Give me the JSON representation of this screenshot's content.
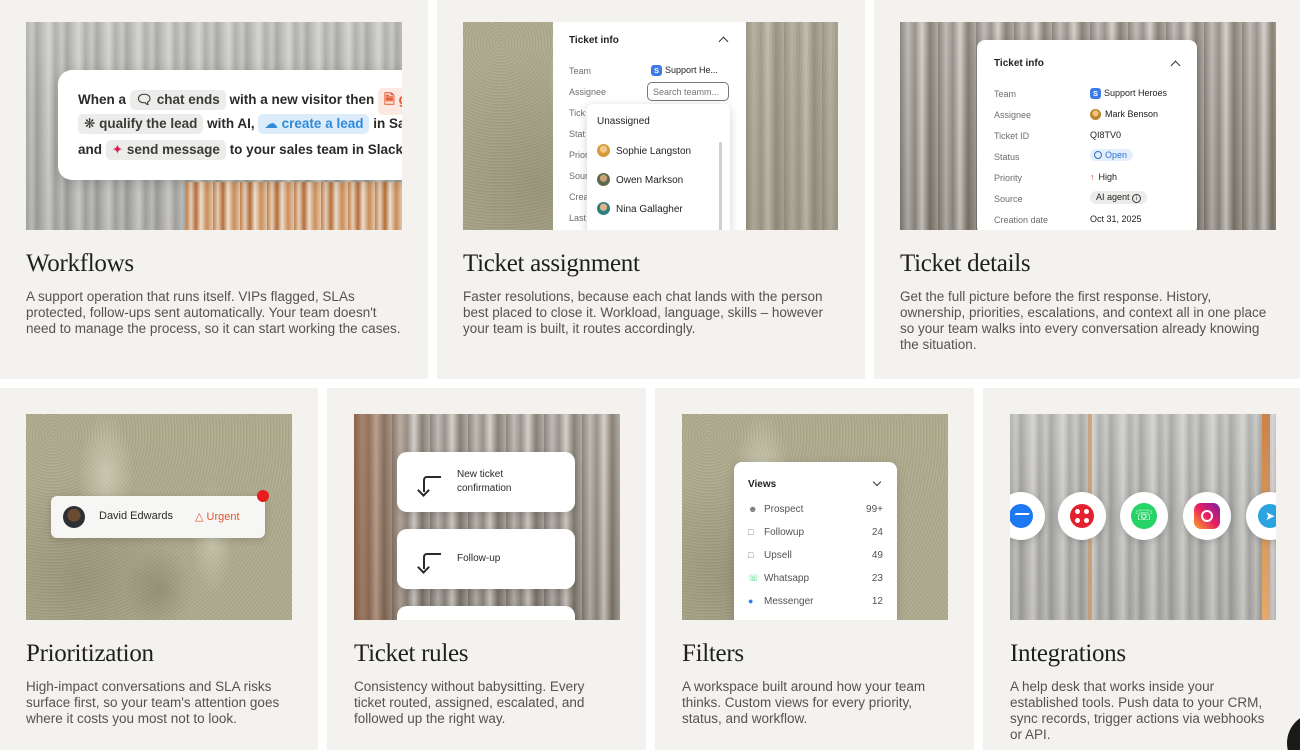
{
  "workflows": {
    "title": "Workflows",
    "desc": "A support operation that runs itself. VIPs flagged, SLAs protected, follow-ups sent automatically. Your team doesn't need to manage the process, so it can start working the cases.",
    "l1_a": "When a",
    "l1_chip": "chat ends",
    "l1_b": "with a new visitor then",
    "l1_chip2": "ge",
    "l2_chip": "qualify the lead",
    "l2_b": "with AI,",
    "l2_chip2": "create a lead",
    "l2_c": "in Sale",
    "l3_a": "and",
    "l3_chip": "send message",
    "l3_b": "to your sales team in Slack"
  },
  "assignment": {
    "title": "Ticket assignment",
    "desc": "Faster resolutions, because each chat lands with the person best placed to close it. Workload, language, skills – however your team is built, it routes accordingly.",
    "panel_title": "Ticket info",
    "team_label": "Team",
    "team_value": "Support He...",
    "assignee_label": "Assignee",
    "search_placeholder": "Search teamm...",
    "cut_labels": [
      "Tick",
      "Stat",
      "Prior",
      "Sour",
      "Crea",
      "Last"
    ],
    "dropdown": [
      "Unassigned",
      "Sophie Langston",
      "Owen Markson",
      "Nina Gallagher"
    ]
  },
  "details": {
    "title": "Ticket details",
    "desc": "Get the full picture before the first response. History, ownership, priorities, escalations, and context all in one place so your team walks into every conversation already knowing the situation.",
    "panel_title": "Ticket info",
    "rows": [
      {
        "label": "Team",
        "value": "Support Heroes"
      },
      {
        "label": "Assignee",
        "value": "Mark Benson"
      },
      {
        "label": "Ticket ID",
        "value": "QI8TV0"
      },
      {
        "label": "Status",
        "value": "Open"
      },
      {
        "label": "Priority",
        "value": "High"
      },
      {
        "label": "Source",
        "value": "AI agent"
      },
      {
        "label": "Creation date",
        "value": "Oct 31, 2025"
      }
    ]
  },
  "prioritization": {
    "title": "Prioritization",
    "desc": "High-impact conversations and SLA risks surface first, so your team's attention goes where it costs you most not to look.",
    "name": "David Edwards",
    "badge": "Urgent"
  },
  "rules": {
    "title": "Ticket rules",
    "desc": "Consistency without babysitting. Every ticket routed, assigned, escalated, and followed up the right way.",
    "card1": "New ticket confirmation",
    "card2": "Follow-up"
  },
  "filters": {
    "title": "Filters",
    "desc": "A workspace built around how your team thinks. Custom views for every priority, status, and workflow.",
    "views_title": "Views",
    "items": [
      {
        "label": "Prospect",
        "count": "99+",
        "icon": "users-icon"
      },
      {
        "label": "Followup",
        "count": "24",
        "icon": "folder-icon"
      },
      {
        "label": "Upsell",
        "count": "49",
        "icon": "folder-icon"
      },
      {
        "label": "Whatsapp",
        "count": "23",
        "icon": "whatsapp-icon"
      },
      {
        "label": "Messenger",
        "count": "12",
        "icon": "messenger-icon"
      }
    ]
  },
  "integrations": {
    "title": "Integrations",
    "desc": "A help desk that works inside your established tools. Push data to your CRM, sync records, trigger actions via webhooks or API.",
    "icons": [
      "messenger-icon",
      "twilio-icon",
      "whatsapp-icon",
      "instagram-icon",
      "telegram-icon"
    ]
  },
  "colors": {
    "card_bg": "#f3f2ee",
    "accent_blue": "#2f8ad9",
    "urgent_red": "#e4572e",
    "whatsapp_green": "#25d366"
  }
}
